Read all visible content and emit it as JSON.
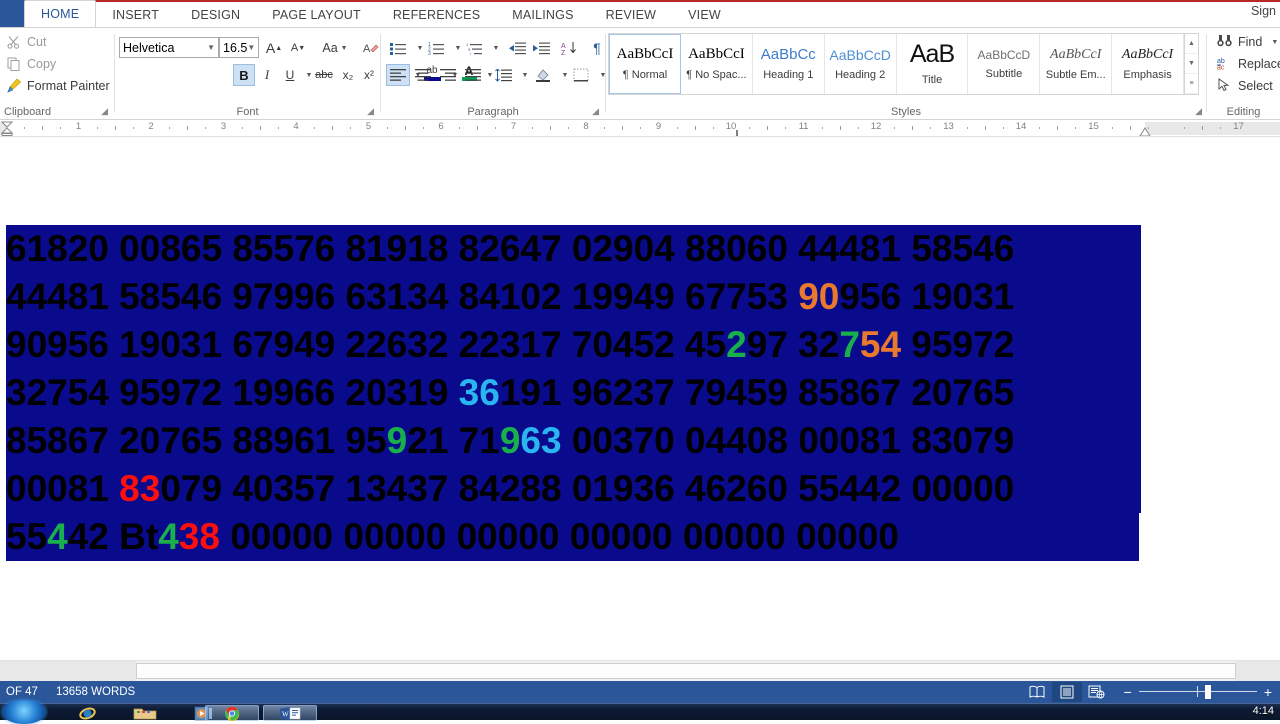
{
  "app": {
    "signin_label": "Sign"
  },
  "tabs": [
    {
      "label": "HOME",
      "active": true
    },
    {
      "label": "INSERT",
      "active": false
    },
    {
      "label": "DESIGN",
      "active": false
    },
    {
      "label": "PAGE LAYOUT",
      "active": false
    },
    {
      "label": "REFERENCES",
      "active": false
    },
    {
      "label": "MAILINGS",
      "active": false
    },
    {
      "label": "REVIEW",
      "active": false
    },
    {
      "label": "VIEW",
      "active": false
    }
  ],
  "ribbon": {
    "clipboard": {
      "label": "Clipboard",
      "cut": "Cut",
      "copy": "Copy",
      "format_painter": "Format Painter"
    },
    "font": {
      "label": "Font",
      "font_name": "Helvetica",
      "font_size": "16.5",
      "grow_font": "A",
      "shrink_font": "A",
      "change_case": "Aa",
      "clear_formatting": "clear-formatting",
      "bold": "B",
      "italic": "I",
      "underline": "U",
      "strikethrough": "abc",
      "subscript": "x₂",
      "superscript": "x²",
      "text_effects": "A",
      "highlight": "ab",
      "font_color": "A",
      "highlight_color": "#0a0a8c",
      "font_color_swatch": "#00a651"
    },
    "paragraph": {
      "label": "Paragraph",
      "bullets": "bullets",
      "numbering": "numbering",
      "multilevel": "multilevel-list",
      "decrease_indent": "decrease-indent",
      "increase_indent": "increase-indent",
      "sort": "sort",
      "show_marks": "¶",
      "align_left": "align-left",
      "align_center": "align-center",
      "align_right": "align-right",
      "justify": "justify",
      "line_spacing": "line-spacing",
      "shading": "shading",
      "borders": "borders"
    },
    "styles": {
      "label": "Styles",
      "items": [
        {
          "preview": "AaBbCcI",
          "name": "¶ Normal",
          "selected": true
        },
        {
          "preview": "AaBbCcI",
          "name": "¶ No Spac...",
          "selected": false
        },
        {
          "preview": "AaBbCс",
          "name": "Heading 1",
          "selected": false
        },
        {
          "preview": "AaBbCcD",
          "name": "Heading 2",
          "selected": false
        },
        {
          "preview": "AaB",
          "name": "Title",
          "selected": false
        },
        {
          "preview": "AaBbCcD",
          "name": "Subtitle",
          "selected": false
        },
        {
          "preview": "AaBbCcI",
          "name": "Subtle Em...",
          "selected": false
        },
        {
          "preview": "AaBbCcI",
          "name": "Emphasis",
          "selected": false
        }
      ]
    },
    "editing": {
      "label": "Editing",
      "find": "Find",
      "replace": "Replace",
      "select": "Select"
    }
  },
  "ruler": {
    "numbers": [
      "1",
      "2",
      "3",
      "4",
      "5",
      "6",
      "7",
      "8",
      "9",
      "10",
      "11",
      "12",
      "13",
      "14",
      "15",
      "17"
    ]
  },
  "document": {
    "highlight_color": "#0a0a8c",
    "default_text_color": "#000000",
    "lines": [
      [
        {
          "t": "61820 00865 85576 81918 82647 02904 88060 44481 58546",
          "c": "#000000"
        }
      ],
      [
        {
          "t": "44481 58546 97996 63134 84102 19949 67753 ",
          "c": "#000000"
        },
        {
          "t": "90",
          "c": "#e8792e"
        },
        {
          "t": "956 19031",
          "c": "#000000"
        }
      ],
      [
        {
          "t": "90956 19031 67949 22632 22317 70452 45",
          "c": "#000000"
        },
        {
          "t": "2",
          "c": "#19b04c"
        },
        {
          "t": "97 32",
          "c": "#000000"
        },
        {
          "t": "7",
          "c": "#19b04c"
        },
        {
          "t": "54",
          "c": "#e8792e"
        },
        {
          "t": " 95972",
          "c": "#000000"
        }
      ],
      [
        {
          "t": "32754 95972 19966 20319 ",
          "c": "#000000"
        },
        {
          "t": "36",
          "c": "#29b6f0"
        },
        {
          "t": "191 96237 79459 85867 20765",
          "c": "#000000"
        }
      ],
      [
        {
          "t": "85867 20765 88961 95",
          "c": "#000000"
        },
        {
          "t": "9",
          "c": "#19b04c"
        },
        {
          "t": "21 71",
          "c": "#000000"
        },
        {
          "t": "9",
          "c": "#19b04c"
        },
        {
          "t": "63",
          "c": "#29b6f0"
        },
        {
          "t": " 00370 04408 00081 83079",
          "c": "#000000"
        }
      ],
      [
        {
          "t": "00081 ",
          "c": "#000000"
        },
        {
          "t": "83",
          "c": "#ff0e0e"
        },
        {
          "t": "079 40357 13437 84288 01936 46260 55442 00000",
          "c": "#000000"
        }
      ],
      [
        {
          "t": "55",
          "c": "#000000"
        },
        {
          "t": "4",
          "c": "#19b04c"
        },
        {
          "t": "42 Bt",
          "c": "#000000"
        },
        {
          "t": "4",
          "c": "#19b04c"
        },
        {
          "t": "38",
          "c": "#ff0e0e"
        },
        {
          "t": " 00000 00000 00000 00000 00000 00000",
          "c": "#000000"
        }
      ]
    ]
  },
  "status": {
    "page_of": "OF 47",
    "word_count": "13658 WORDS",
    "view_read": "read-mode",
    "view_print": "print-layout",
    "view_web": "web-layout",
    "zoom_minus": "−",
    "zoom_plus": "+"
  },
  "taskbar": {
    "clock": "4:14",
    "items": [
      {
        "name": "internet-explorer",
        "running": false
      },
      {
        "name": "windows-explorer",
        "running": false
      },
      {
        "name": "media-player",
        "running": false
      },
      {
        "name": "google-chrome",
        "running": true
      },
      {
        "name": "microsoft-word",
        "running": true
      }
    ]
  }
}
